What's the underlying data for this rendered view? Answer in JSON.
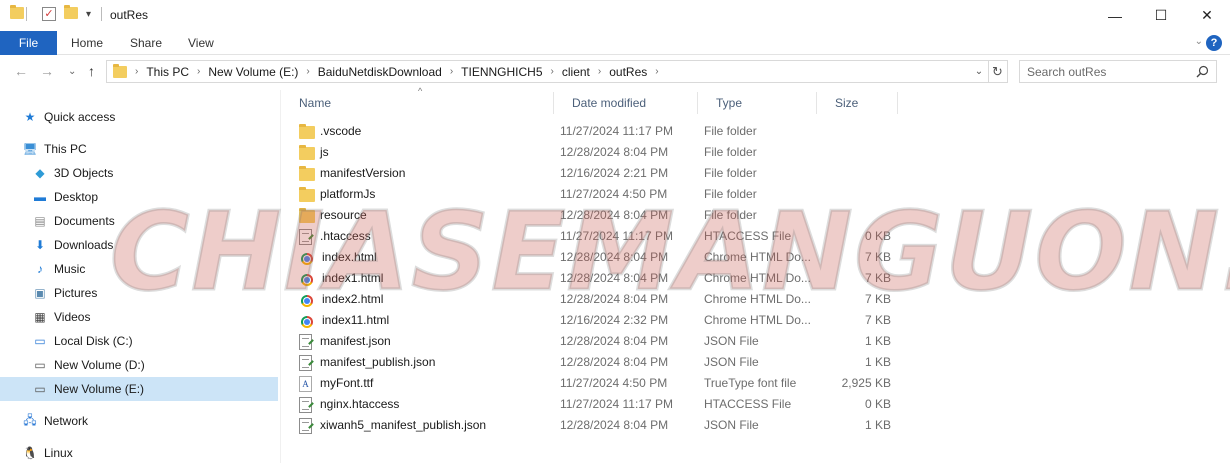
{
  "window": {
    "title": "outRes",
    "minimize_glyph": "—",
    "maximize_glyph": "☐",
    "close_glyph": "✕"
  },
  "quick_access_toolbar": {
    "dropdown_glyph": "▾"
  },
  "ribbon": {
    "tabs": [
      "File",
      "Home",
      "Share",
      "View"
    ],
    "expand_glyph": "⌄",
    "help_glyph": "?"
  },
  "navigation": {
    "back_glyph": "←",
    "forward_glyph": "→",
    "recent_glyph": "⌄",
    "up_glyph": "↑",
    "breadcrumb": [
      "This PC",
      "New Volume (E:)",
      "BaiduNetdiskDownload",
      "TIENNGHICH5",
      "client",
      "outRes"
    ],
    "crumb_separator": "›",
    "dropdown_glyph": "⌄",
    "refresh_glyph": "↻"
  },
  "search": {
    "placeholder": "Search outRes"
  },
  "sidebar": {
    "items": [
      {
        "label": "Quick access",
        "icon": "star-icon",
        "glyph": "★",
        "color": "#1f7bd6"
      },
      {
        "label": "This PC",
        "icon": "computer-icon",
        "glyph": "🖥",
        "color": "#3a8fd6"
      },
      {
        "label": "3D Objects",
        "icon": "cube-icon",
        "glyph": "◆",
        "color": "#2e9bd6"
      },
      {
        "label": "Desktop",
        "icon": "desktop-icon",
        "glyph": "▬",
        "color": "#1f7bd6"
      },
      {
        "label": "Documents",
        "icon": "document-icon",
        "glyph": "▤",
        "color": "#888888"
      },
      {
        "label": "Downloads",
        "icon": "download-icon",
        "glyph": "⬇",
        "color": "#1f7bd6"
      },
      {
        "label": "Music",
        "icon": "music-icon",
        "glyph": "♪",
        "color": "#1f7bd6"
      },
      {
        "label": "Pictures",
        "icon": "pictures-icon",
        "glyph": "▣",
        "color": "#5a8ab0"
      },
      {
        "label": "Videos",
        "icon": "video-icon",
        "glyph": "▦",
        "color": "#444444"
      },
      {
        "label": "Local Disk (C:)",
        "icon": "drive-windows-icon",
        "glyph": "▭",
        "color": "#2e7bd6"
      },
      {
        "label": "New Volume (D:)",
        "icon": "drive-icon",
        "glyph": "▭",
        "color": "#555555"
      },
      {
        "label": "New Volume (E:)",
        "icon": "drive-icon",
        "glyph": "▭",
        "color": "#555555",
        "selected": true
      },
      {
        "label": "Network",
        "icon": "network-icon",
        "glyph": "🖧",
        "color": "#2e7bd6"
      },
      {
        "label": "Linux",
        "icon": "linux-icon",
        "glyph": "🐧",
        "color": "#222222"
      }
    ]
  },
  "file_list": {
    "sort_glyph": "^",
    "columns": [
      "Name",
      "Date modified",
      "Type",
      "Size"
    ],
    "rows": [
      {
        "name": ".vscode",
        "date": "11/27/2024 11:17 PM",
        "type": "File folder",
        "size": "",
        "icon": "folder"
      },
      {
        "name": "js",
        "date": "12/28/2024 8:04 PM",
        "type": "File folder",
        "size": "",
        "icon": "folder"
      },
      {
        "name": "manifestVersion",
        "date": "12/16/2024 2:21 PM",
        "type": "File folder",
        "size": "",
        "icon": "folder"
      },
      {
        "name": "platformJs",
        "date": "11/27/2024 4:50 PM",
        "type": "File folder",
        "size": "",
        "icon": "folder"
      },
      {
        "name": "resource",
        "date": "12/28/2024 8:04 PM",
        "type": "File folder",
        "size": "",
        "icon": "folder"
      },
      {
        "name": ".htaccess",
        "date": "11/27/2024 11:17 PM",
        "type": "HTACCESS File",
        "size": "0 KB",
        "icon": "text"
      },
      {
        "name": "index.html",
        "date": "12/28/2024 8:04 PM",
        "type": "Chrome HTML Do...",
        "size": "7 KB",
        "icon": "chrome"
      },
      {
        "name": "index1.html",
        "date": "12/28/2024 8:04 PM",
        "type": "Chrome HTML Do...",
        "size": "7 KB",
        "icon": "chrome"
      },
      {
        "name": "index2.html",
        "date": "12/28/2024 8:04 PM",
        "type": "Chrome HTML Do...",
        "size": "7 KB",
        "icon": "chrome"
      },
      {
        "name": "index11.html",
        "date": "12/16/2024 2:32 PM",
        "type": "Chrome HTML Do...",
        "size": "7 KB",
        "icon": "chrome"
      },
      {
        "name": "manifest.json",
        "date": "12/28/2024 8:04 PM",
        "type": "JSON File",
        "size": "1 KB",
        "icon": "text"
      },
      {
        "name": "manifest_publish.json",
        "date": "12/28/2024 8:04 PM",
        "type": "JSON File",
        "size": "1 KB",
        "icon": "text"
      },
      {
        "name": "myFont.ttf",
        "date": "11/27/2024 4:50 PM",
        "type": "TrueType font file",
        "size": "2,925 KB",
        "icon": "font",
        "glyph": "A"
      },
      {
        "name": "nginx.htaccess",
        "date": "11/27/2024 11:17 PM",
        "type": "HTACCESS File",
        "size": "0 KB",
        "icon": "text"
      },
      {
        "name": "xiwanh5_manifest_publish.json",
        "date": "12/28/2024 8:04 PM",
        "type": "JSON File",
        "size": "1 KB",
        "icon": "text"
      }
    ]
  },
  "watermark": {
    "text": "CHIASEMANGUON.COM"
  }
}
